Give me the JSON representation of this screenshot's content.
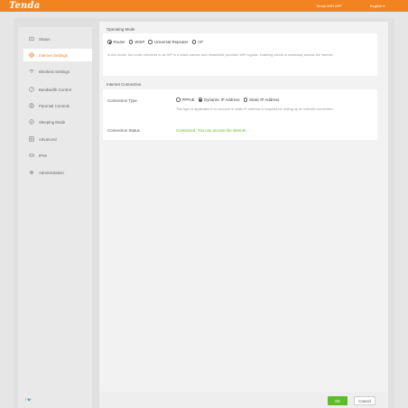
{
  "header": {
    "logo": "Tenda",
    "app_link": "Tenda WiFi APP",
    "language": "English ▾"
  },
  "sidebar": {
    "items": [
      {
        "label": "Status",
        "icon": "status-icon"
      },
      {
        "label": "Internet Settings",
        "icon": "globe-icon",
        "active": true
      },
      {
        "label": "Wireless Settings",
        "icon": "wifi-icon"
      },
      {
        "label": "Bandwidth Control",
        "icon": "gauge-icon"
      },
      {
        "label": "Parental Controls",
        "icon": "parental-icon"
      },
      {
        "label": "Sleeping Mode",
        "icon": "sleep-icon"
      },
      {
        "label": "Advanced",
        "icon": "grid-icon"
      },
      {
        "label": "IPv6",
        "icon": "ipv6-icon"
      },
      {
        "label": "Administration",
        "icon": "gear-icon"
      }
    ],
    "social": "f  🐦"
  },
  "operating_mode": {
    "title": "Operating Mode",
    "options": [
      "Router",
      "WISP",
      "Universal Repeater",
      "AP"
    ],
    "selected": "Router",
    "description": "In this mode, the router connects to an ISP in a wired manner and meanwhile provides WiFi signals, enabling clients to wirelessly access the internet."
  },
  "internet_connection": {
    "title": "Internet Connection",
    "type_label": "Connection Type",
    "type_options": [
      "PPPoE",
      "Dynamic IP Address",
      "Static IP Address"
    ],
    "type_selected": "Dynamic IP Address",
    "type_description": "This type is applicable if no account or static IP address is required for setting up an internet connection.",
    "status_label": "Connection Status",
    "status_value": "Connected. You can access the internet."
  },
  "footer": {
    "ok_label": "OK",
    "cancel_label": "Cancel"
  },
  "colors": {
    "brand": "#f18421",
    "ok_green": "#5bbd27"
  }
}
